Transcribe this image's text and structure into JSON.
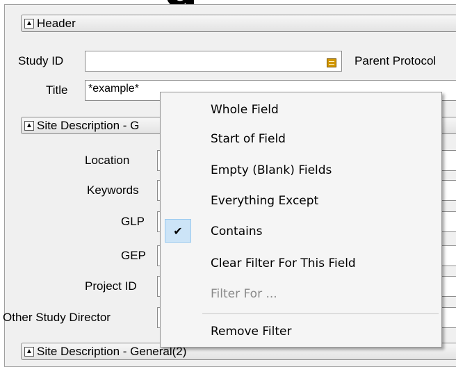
{
  "top_fragment": "g",
  "sections": {
    "header": "Header",
    "site_description_1": "Site Description - G",
    "site_description_2": "Site Description - General(2)"
  },
  "fields": {
    "study_id_label": "Study ID",
    "study_id_value": "",
    "parent_protocol_label": "Parent Protocol",
    "title_label": "Title",
    "title_value": "*example*",
    "location_label": "Location",
    "keywords_label": "Keywords",
    "glp_label": "GLP",
    "gep_label": "GEP",
    "project_id_label": "Project ID",
    "other_study_director_label": "Other Study Director"
  },
  "context_menu": {
    "items": [
      {
        "label": "Whole Field",
        "checked": false,
        "disabled": false
      },
      {
        "label": "Start of Field",
        "checked": false,
        "disabled": false
      },
      {
        "label": "Empty (Blank) Fields",
        "checked": false,
        "disabled": false
      },
      {
        "label": "Everything Except",
        "checked": false,
        "disabled": false
      },
      {
        "label": "Contains",
        "checked": true,
        "disabled": false
      },
      {
        "label": "Clear Filter For This Field",
        "checked": false,
        "disabled": false
      },
      {
        "label": "Filter For ...",
        "checked": false,
        "disabled": true
      },
      {
        "label": "Remove Filter",
        "checked": false,
        "disabled": false
      }
    ],
    "check_glyph": "✔"
  },
  "colors": {
    "panel_bg": "#f0f0f0",
    "menu_bg": "#f5f5f5",
    "check_highlight": "#cce4f7",
    "note_icon": "#d29700",
    "disabled_text": "#8a8a8a"
  }
}
